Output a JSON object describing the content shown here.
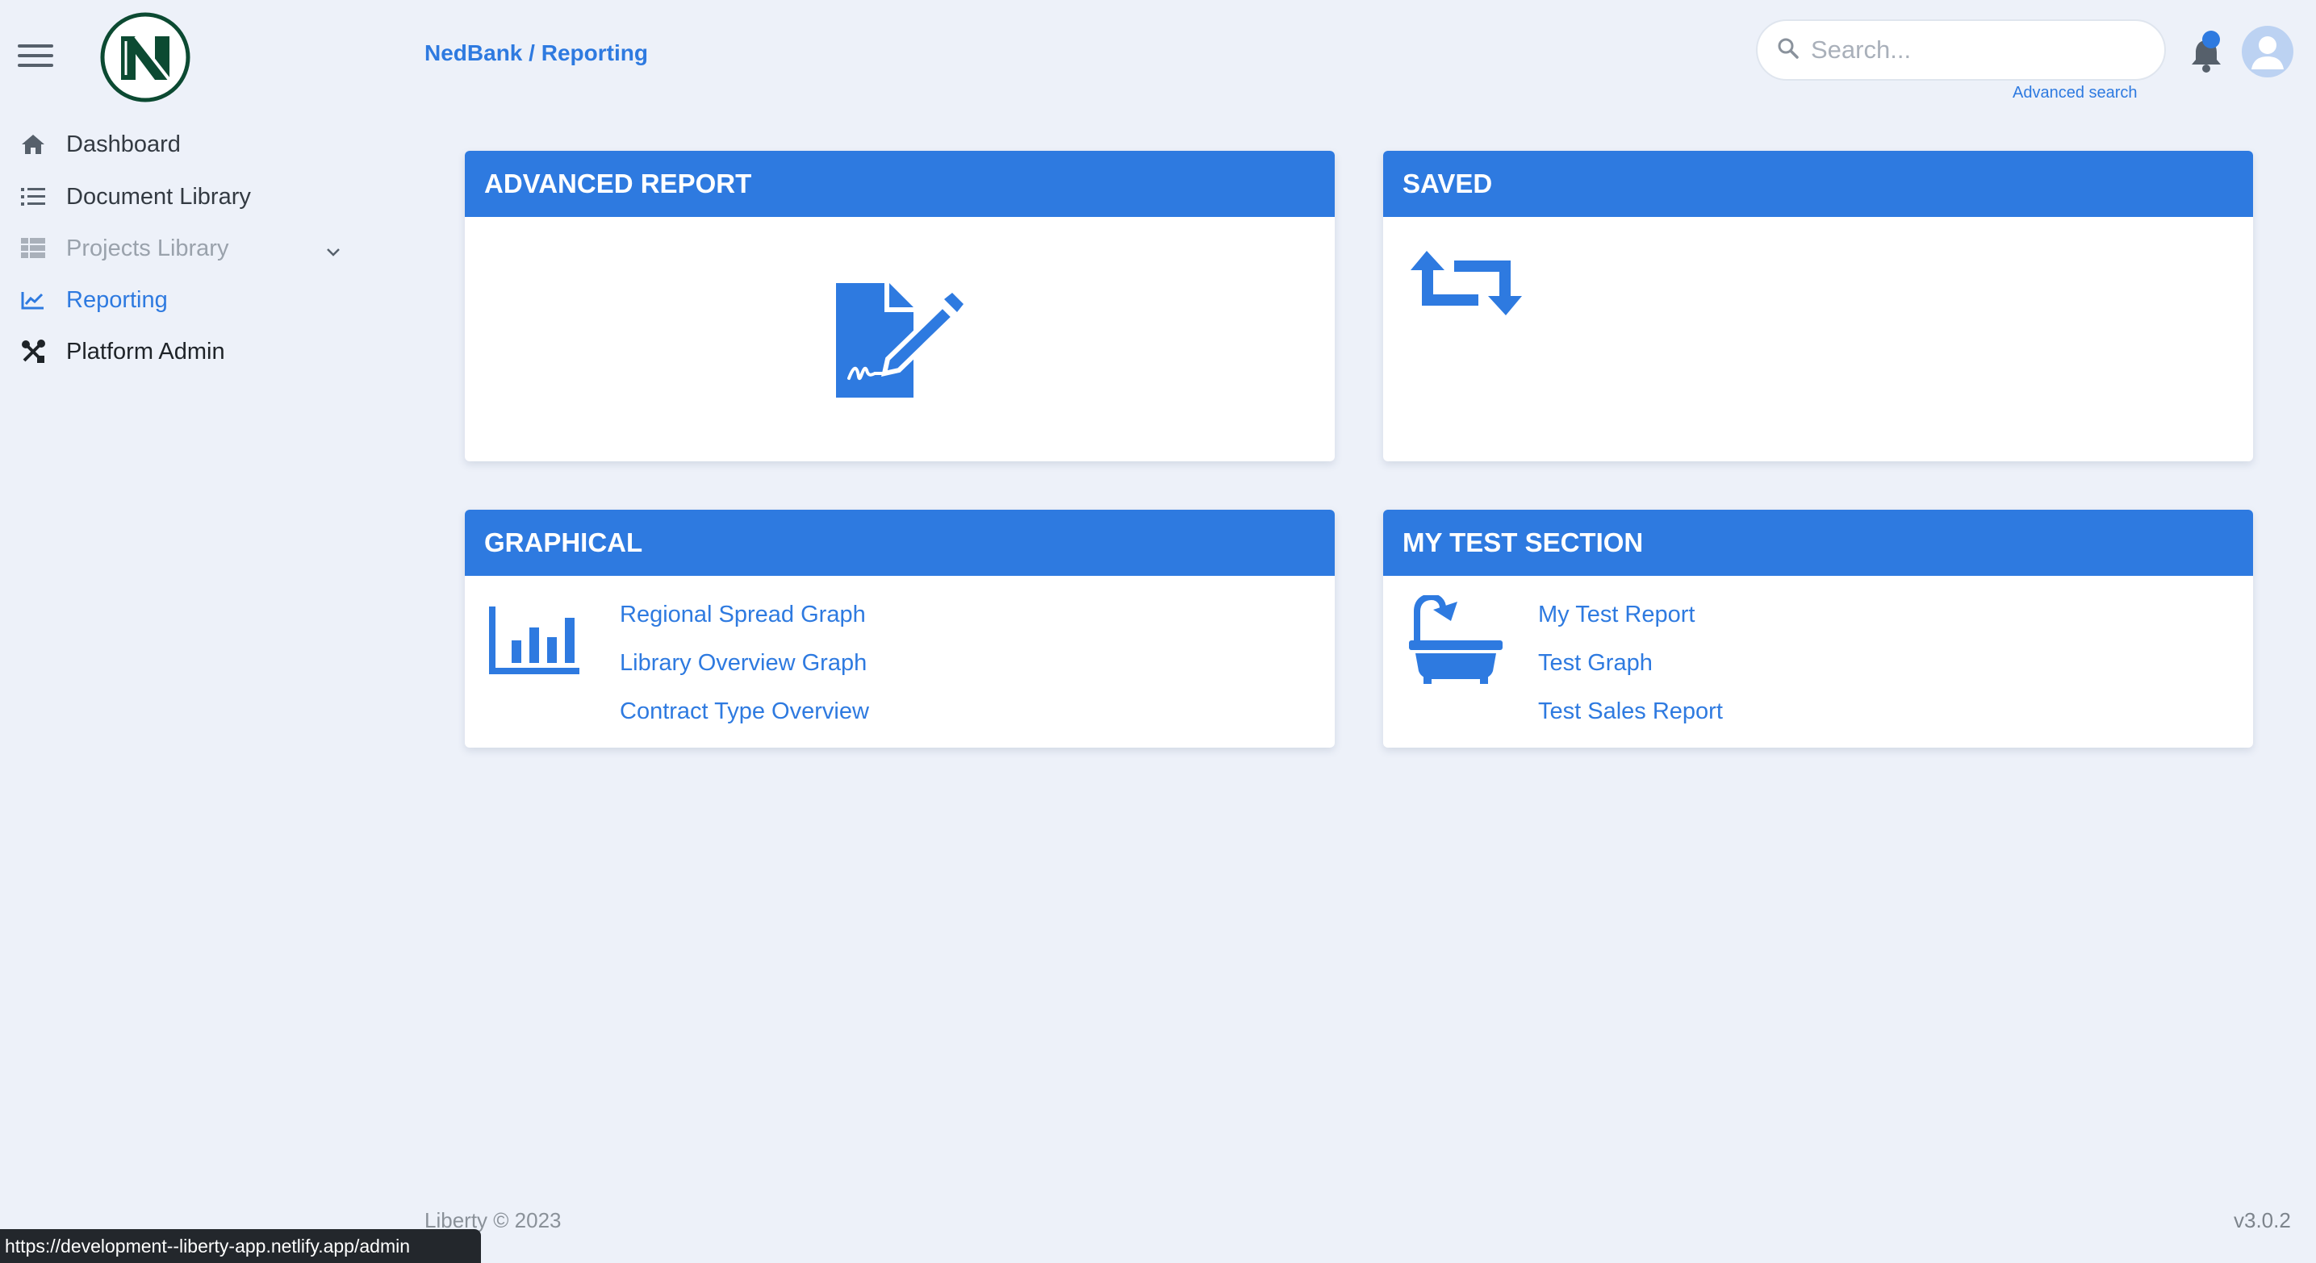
{
  "brand": {
    "name": "NedBank",
    "logo_color": "#0c4a32"
  },
  "breadcrumb": {
    "root": "NedBank",
    "separator": " / ",
    "current": "Reporting"
  },
  "sidebar": {
    "items": [
      {
        "label": "Dashboard",
        "icon": "home-icon",
        "state": "default"
      },
      {
        "label": "Document Library",
        "icon": "list-icon",
        "state": "default"
      },
      {
        "label": "Projects Library",
        "icon": "table-icon",
        "state": "disabled"
      },
      {
        "label": "Reporting",
        "icon": "chart-line-icon",
        "state": "active"
      },
      {
        "label": "Platform Admin",
        "icon": "tools-icon",
        "state": "hover"
      }
    ]
  },
  "search": {
    "placeholder": "Search...",
    "advanced_label": "Advanced search"
  },
  "cards": {
    "advanced_report": {
      "title": "ADVANCED REPORT",
      "icon": "file-signature-icon"
    },
    "saved": {
      "title": "SAVED",
      "icon": "retweet-icon"
    },
    "graphical": {
      "title": "GRAPHICAL",
      "icon": "bar-chart-icon",
      "links": [
        "Regional Spread Graph",
        "Library Overview Graph",
        "Contract Type Overview"
      ]
    },
    "my_test_section": {
      "title": "MY TEST SECTION",
      "icon": "bathtub-icon",
      "links": [
        "My Test Report",
        "Test Graph",
        "Test Sales Report"
      ]
    }
  },
  "footer": {
    "copyright": "Liberty © 2023",
    "version": "v3.0.2"
  },
  "statusbar": {
    "url": "https://development--liberty-app.netlify.app/admin"
  },
  "colors": {
    "accent": "#2e7ae0",
    "background": "#edf1f9",
    "card_header": "#2e7ae0"
  }
}
